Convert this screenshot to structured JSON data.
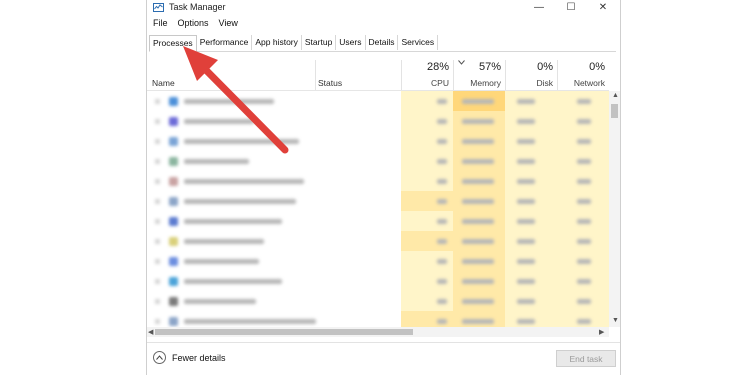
{
  "window": {
    "title": "Task Manager"
  },
  "titlebar_buttons": {
    "minimize": "—",
    "maximize": "☐",
    "close": "✕"
  },
  "menu": [
    "File",
    "Options",
    "View"
  ],
  "tabs": [
    "Processes",
    "Performance",
    "App history",
    "Startup",
    "Users",
    "Details",
    "Services"
  ],
  "header": {
    "name": "Name",
    "status": "Status",
    "cpu": {
      "percent": "28%",
      "label": "CPU"
    },
    "memory": {
      "percent": "57%",
      "label": "Memory"
    },
    "disk": {
      "percent": "0%",
      "label": "Disk"
    },
    "network": {
      "percent": "0%",
      "label": "Network"
    }
  },
  "footer": {
    "fewer_details": "Fewer details",
    "end_task": "End task"
  },
  "icons": {
    "app": "task-manager-icon",
    "sort": "sort-chevron-icon",
    "fewer": "chevron-up-icon"
  },
  "colors": {
    "annotation_arrow": "#e0403a",
    "cpu_col": "#fff5c9",
    "memory_col": "#ffe9a8"
  }
}
